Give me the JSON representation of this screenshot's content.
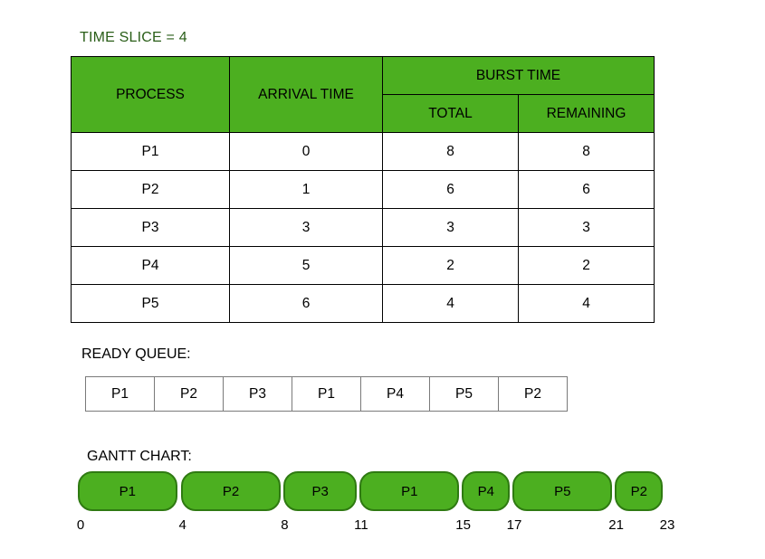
{
  "time_slice": {
    "label": "TIME SLICE = 4",
    "value": 4,
    "color": "#2a5e18"
  },
  "theme": {
    "accent_green": "#4CAF20",
    "accent_green_border": "#2f7a12",
    "grid_line": "#000000"
  },
  "process_table": {
    "headers": {
      "process": "PROCESS",
      "arrival_time": "ARRIVAL TIME",
      "burst_time": "BURST TIME",
      "burst_total": "TOTAL",
      "burst_remaining": "REMAINING"
    },
    "rows": [
      {
        "process": "P1",
        "arrival": "0",
        "total": "8",
        "remaining": "8"
      },
      {
        "process": "P2",
        "arrival": "1",
        "total": "6",
        "remaining": "6"
      },
      {
        "process": "P3",
        "arrival": "3",
        "total": "3",
        "remaining": "3"
      },
      {
        "process": "P4",
        "arrival": "5",
        "total": "2",
        "remaining": "2"
      },
      {
        "process": "P5",
        "arrival": "6",
        "total": "4",
        "remaining": "4"
      }
    ]
  },
  "ready_queue": {
    "heading": "READY QUEUE:",
    "items": [
      "P1",
      "P2",
      "P3",
      "P1",
      "P4",
      "P5",
      "P2"
    ]
  },
  "gantt": {
    "heading": "GANTT CHART:",
    "ticks": [
      "0",
      "4",
      "8",
      "11",
      "15",
      "17",
      "21",
      "23"
    ],
    "bars": [
      {
        "label": "P1",
        "start": 0,
        "end": 4
      },
      {
        "label": "P2",
        "start": 4,
        "end": 8
      },
      {
        "label": "P3",
        "start": 8,
        "end": 11
      },
      {
        "label": "P1",
        "start": 11,
        "end": 15
      },
      {
        "label": "P4",
        "start": 15,
        "end": 17
      },
      {
        "label": "P5",
        "start": 17,
        "end": 21
      },
      {
        "label": "P2",
        "start": 21,
        "end": 23
      }
    ]
  },
  "chart_data": {
    "type": "bar",
    "title": "GANTT CHART:",
    "xlabel": "",
    "ylabel": "",
    "xlim": [
      0,
      23
    ],
    "grid": false,
    "legend": "none",
    "categories": [
      "P1",
      "P2",
      "P3",
      "P1",
      "P4",
      "P5",
      "P2"
    ],
    "values": [
      4,
      4,
      3,
      4,
      2,
      4,
      2
    ],
    "segments": [
      {
        "process": "P1",
        "start": 0,
        "end": 4,
        "duration": 4
      },
      {
        "process": "P2",
        "start": 4,
        "end": 8,
        "duration": 4
      },
      {
        "process": "P3",
        "start": 8,
        "end": 11,
        "duration": 3
      },
      {
        "process": "P1",
        "start": 11,
        "end": 15,
        "duration": 4
      },
      {
        "process": "P4",
        "start": 15,
        "end": 17,
        "duration": 2
      },
      {
        "process": "P5",
        "start": 17,
        "end": 21,
        "duration": 4
      },
      {
        "process": "P2",
        "start": 21,
        "end": 23,
        "duration": 2
      }
    ],
    "tick_labels": [
      "0",
      "4",
      "8",
      "11",
      "15",
      "17",
      "21",
      "23"
    ],
    "annotations": [
      "TIME SLICE = 4",
      "READY QUEUE:",
      "GANTT CHART:"
    ]
  }
}
